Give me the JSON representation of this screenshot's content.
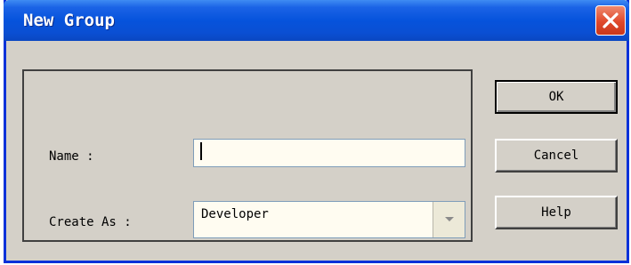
{
  "window": {
    "title": "New Group"
  },
  "form": {
    "name_label": "Name :",
    "name_value": "",
    "create_as_label": "Create As :",
    "create_as_value": "Developer"
  },
  "buttons": {
    "ok": "OK",
    "cancel": "Cancel",
    "help": "Help"
  },
  "icons": {
    "close": "close-icon",
    "dropdown": "chevron-down-icon"
  },
  "colors": {
    "titlebar": "#0653dc",
    "dialog_bg": "#d4d0c8",
    "close_button": "#e0482b"
  }
}
